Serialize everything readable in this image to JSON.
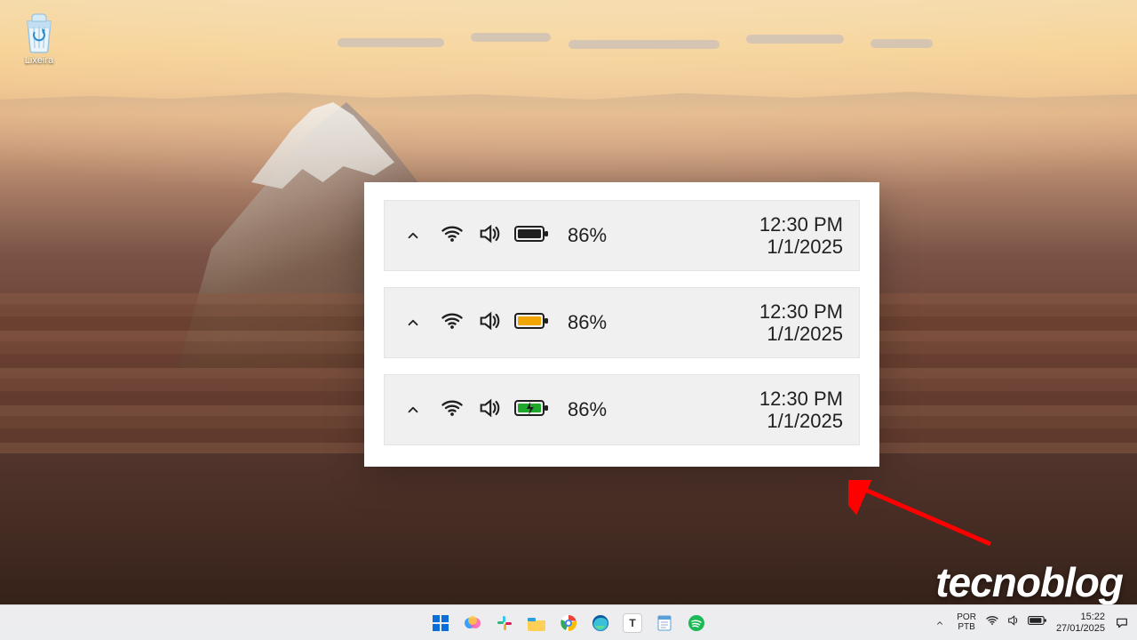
{
  "desktop": {
    "recycle_bin_label": "Lixeira"
  },
  "card": {
    "rows": [
      {
        "battery_pct": "86%",
        "time": "12:30 PM",
        "date": "1/1/2025",
        "battery_color": "#1f1f1f",
        "charging": false
      },
      {
        "battery_pct": "86%",
        "time": "12:30 PM",
        "date": "1/1/2025",
        "battery_color": "#f0a500",
        "charging": false
      },
      {
        "battery_pct": "86%",
        "time": "12:30 PM",
        "date": "1/1/2025",
        "battery_color": "#1fa82c",
        "charging": true
      }
    ]
  },
  "watermark": {
    "text": "tecnoblog"
  },
  "taskbar": {
    "lang_top": "POR",
    "lang_bottom": "PTB",
    "time": "15:22",
    "date": "27/01/2025",
    "pinned": [
      {
        "name": "start",
        "label": ""
      },
      {
        "name": "copilot",
        "label": ""
      },
      {
        "name": "slack",
        "label": ""
      },
      {
        "name": "explorer",
        "label": ""
      },
      {
        "name": "chrome",
        "label": ""
      },
      {
        "name": "edge",
        "label": ""
      },
      {
        "name": "text-app",
        "label": "T"
      },
      {
        "name": "notepad",
        "label": ""
      },
      {
        "name": "spotify",
        "label": ""
      }
    ]
  }
}
